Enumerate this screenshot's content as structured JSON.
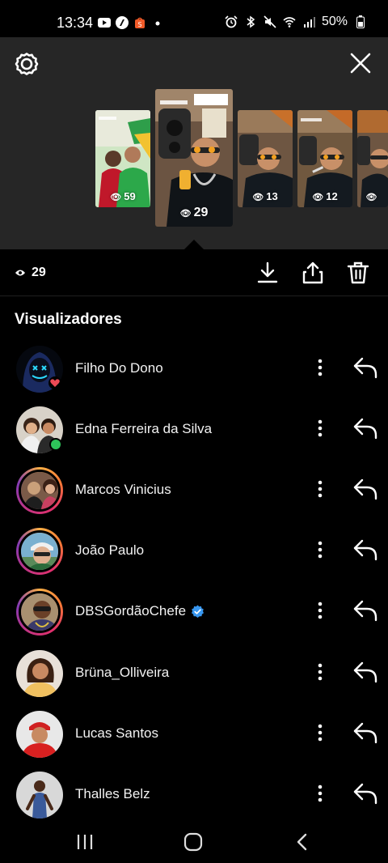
{
  "status_bar": {
    "time": "13:34",
    "battery": "50%",
    "left_icons": [
      "youtube-icon",
      "app-icon",
      "shopee-icon",
      "dot-icon"
    ],
    "right_icons": [
      "alarm-icon",
      "bluetooth-icon",
      "mute-icon",
      "wifi-icon",
      "signal-icon",
      "battery-icon"
    ]
  },
  "stories": [
    {
      "views": "59"
    },
    {
      "views": "29"
    },
    {
      "views": "13"
    },
    {
      "views": "12"
    },
    {
      "views": ""
    }
  ],
  "selected_story": {
    "views": "29"
  },
  "section_title": "Visualizadores",
  "viewers": [
    {
      "name": "Filho Do Dono",
      "verified": false,
      "ring": false,
      "badge": "heart"
    },
    {
      "name": "Edna Ferreira da Silva",
      "verified": false,
      "ring": false,
      "badge": "online"
    },
    {
      "name": "Marcos Vinicius",
      "verified": false,
      "ring": true,
      "badge": ""
    },
    {
      "name": "João Paulo",
      "verified": false,
      "ring": true,
      "badge": ""
    },
    {
      "name": "DBSGordãoChefe",
      "verified": true,
      "ring": true,
      "badge": ""
    },
    {
      "name": "Brüna_Olliveira",
      "verified": false,
      "ring": false,
      "badge": ""
    },
    {
      "name": "Lucas Santos",
      "verified": false,
      "ring": false,
      "badge": ""
    },
    {
      "name": "Thalles Belz",
      "verified": false,
      "ring": false,
      "badge": ""
    }
  ],
  "colors": {
    "panel": "#262626",
    "background": "#000000",
    "verified": "#3897f0",
    "online": "#2ec45a",
    "heart": "#ed4956"
  }
}
